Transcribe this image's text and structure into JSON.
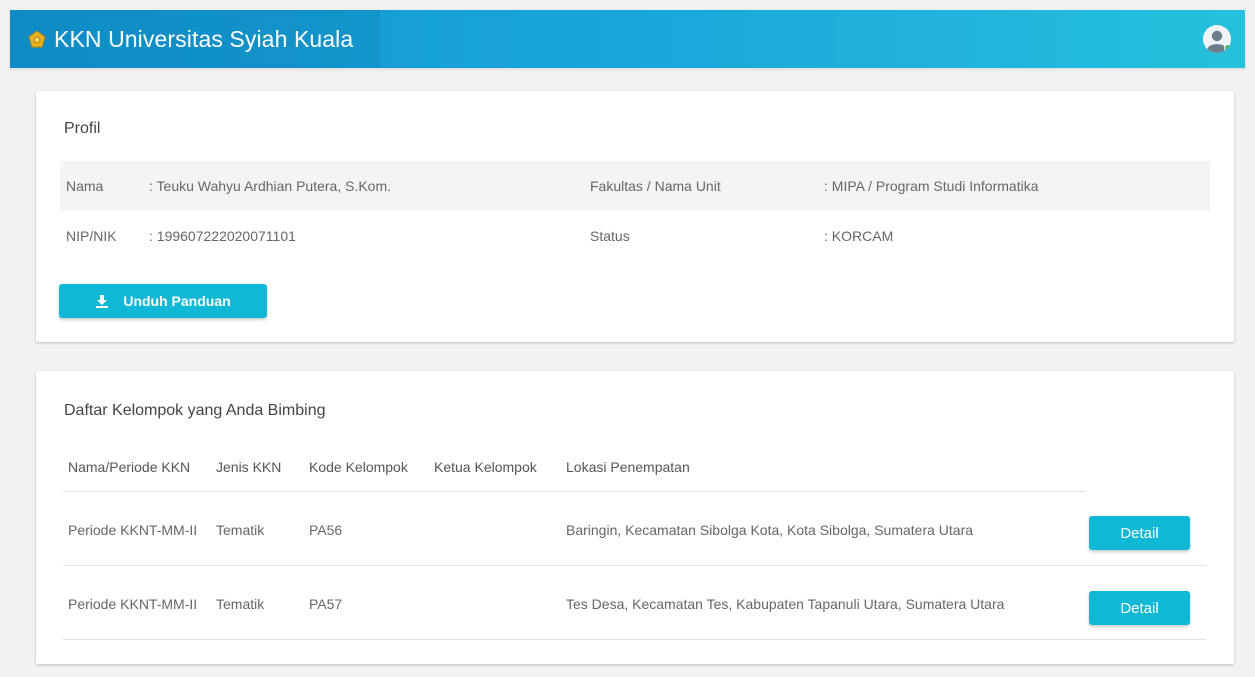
{
  "header": {
    "title": "KKN Universitas Syiah Kuala",
    "logo_icon": "university-emblem-icon",
    "user_icon": "user-avatar-icon",
    "colors": {
      "bar_start": "#0f94d2",
      "bar_end": "#25c1dc",
      "accent": "#0fb8d4",
      "online": "#4caf50"
    }
  },
  "profile": {
    "title": "Profil",
    "rows": [
      {
        "label1": "Nama",
        "value1": ": Teuku Wahyu Ardhian Putera, S.Kom.",
        "label2": "Fakultas / Nama Unit",
        "value2": ": MIPA / Program Studi Informatika"
      },
      {
        "label1": "NIP/NIK",
        "value1": ": 199607222020071101",
        "label2": "Status",
        "value2": ": KORCAM"
      }
    ],
    "download_button": {
      "label": "Unduh Panduan",
      "icon": "download-icon"
    }
  },
  "groups": {
    "title": "Daftar Kelompok yang Anda Bimbing",
    "columns": [
      "Nama/Periode KKN",
      "Jenis KKN",
      "Kode Kelompok",
      "Ketua Kelompok",
      "Lokasi Penempatan"
    ],
    "rows": [
      {
        "periode": "Periode KKNT-MM-II",
        "jenis": "Tematik",
        "kode": "PA56",
        "ketua": "",
        "lokasi": "Baringin, Kecamatan Sibolga Kota, Kota Sibolga, Sumatera Utara",
        "action": "Detail"
      },
      {
        "periode": "Periode KKNT-MM-II",
        "jenis": "Tematik",
        "kode": "PA57",
        "ketua": "",
        "lokasi": "Tes Desa, Kecamatan Tes, Kabupaten Tapanuli Utara, Sumatera Utara",
        "action": "Detail"
      }
    ]
  }
}
